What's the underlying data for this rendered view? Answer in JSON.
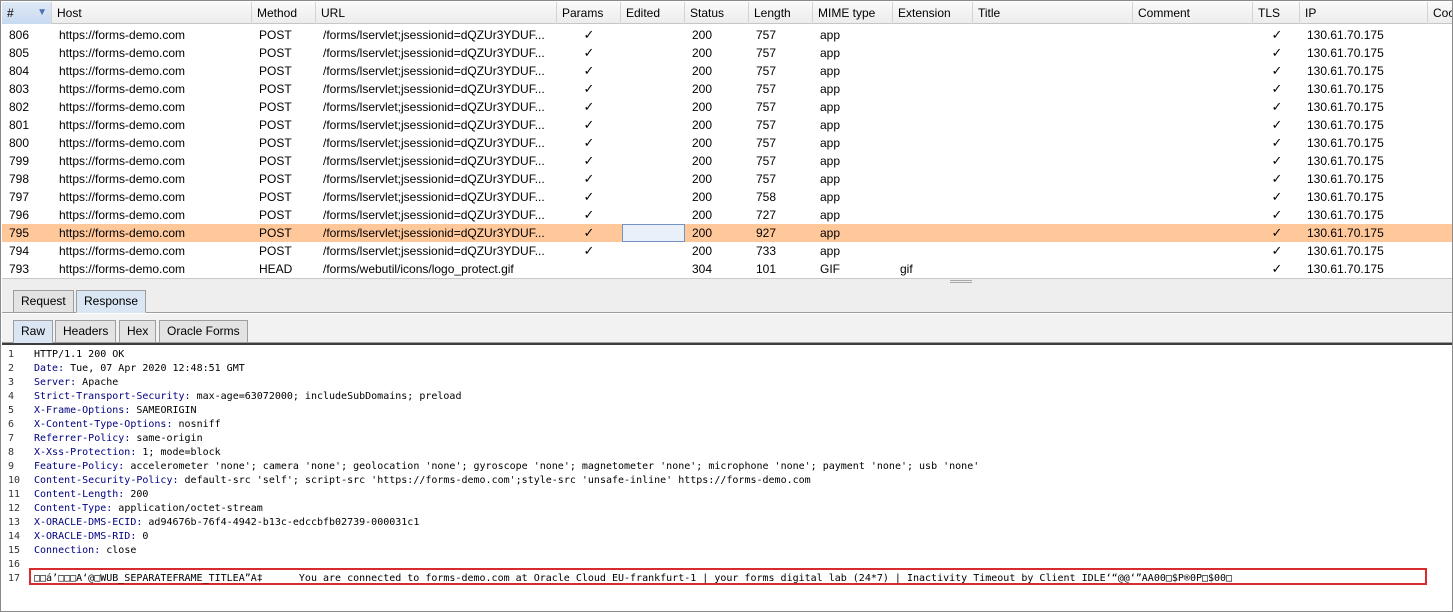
{
  "table": {
    "columns": [
      "#",
      "Host",
      "Method",
      "URL",
      "Params",
      "Edited",
      "Status",
      "Length",
      "MIME type",
      "Extension",
      "Title",
      "Comment",
      "TLS",
      "IP",
      "Cookies"
    ],
    "columns_visible": [
      "#",
      "Host",
      "Method",
      "URL",
      "Params",
      "Edited",
      "Status",
      "Length",
      "MIME type",
      "Extension",
      "Title",
      "Comment",
      "TLS",
      "IP",
      "Coo"
    ],
    "sort_indicator": "▼",
    "check": "✓",
    "rows": [
      {
        "num": "806",
        "host": "https://forms-demo.com",
        "method": "POST",
        "url": "/forms/lservlet;jsessionid=dQZUr3YDUF...",
        "params": true,
        "status": "200",
        "length": "757",
        "mime": "app",
        "ext": "",
        "tls": true,
        "ip": "130.61.70.175"
      },
      {
        "num": "805",
        "host": "https://forms-demo.com",
        "method": "POST",
        "url": "/forms/lservlet;jsessionid=dQZUr3YDUF...",
        "params": true,
        "status": "200",
        "length": "757",
        "mime": "app",
        "ext": "",
        "tls": true,
        "ip": "130.61.70.175"
      },
      {
        "num": "804",
        "host": "https://forms-demo.com",
        "method": "POST",
        "url": "/forms/lservlet;jsessionid=dQZUr3YDUF...",
        "params": true,
        "status": "200",
        "length": "757",
        "mime": "app",
        "ext": "",
        "tls": true,
        "ip": "130.61.70.175"
      },
      {
        "num": "803",
        "host": "https://forms-demo.com",
        "method": "POST",
        "url": "/forms/lservlet;jsessionid=dQZUr3YDUF...",
        "params": true,
        "status": "200",
        "length": "757",
        "mime": "app",
        "ext": "",
        "tls": true,
        "ip": "130.61.70.175"
      },
      {
        "num": "802",
        "host": "https://forms-demo.com",
        "method": "POST",
        "url": "/forms/lservlet;jsessionid=dQZUr3YDUF...",
        "params": true,
        "status": "200",
        "length": "757",
        "mime": "app",
        "ext": "",
        "tls": true,
        "ip": "130.61.70.175"
      },
      {
        "num": "801",
        "host": "https://forms-demo.com",
        "method": "POST",
        "url": "/forms/lservlet;jsessionid=dQZUr3YDUF...",
        "params": true,
        "status": "200",
        "length": "757",
        "mime": "app",
        "ext": "",
        "tls": true,
        "ip": "130.61.70.175"
      },
      {
        "num": "800",
        "host": "https://forms-demo.com",
        "method": "POST",
        "url": "/forms/lservlet;jsessionid=dQZUr3YDUF...",
        "params": true,
        "status": "200",
        "length": "757",
        "mime": "app",
        "ext": "",
        "tls": true,
        "ip": "130.61.70.175"
      },
      {
        "num": "799",
        "host": "https://forms-demo.com",
        "method": "POST",
        "url": "/forms/lservlet;jsessionid=dQZUr3YDUF...",
        "params": true,
        "status": "200",
        "length": "757",
        "mime": "app",
        "ext": "",
        "tls": true,
        "ip": "130.61.70.175"
      },
      {
        "num": "798",
        "host": "https://forms-demo.com",
        "method": "POST",
        "url": "/forms/lservlet;jsessionid=dQZUr3YDUF...",
        "params": true,
        "status": "200",
        "length": "757",
        "mime": "app",
        "ext": "",
        "tls": true,
        "ip": "130.61.70.175"
      },
      {
        "num": "797",
        "host": "https://forms-demo.com",
        "method": "POST",
        "url": "/forms/lservlet;jsessionid=dQZUr3YDUF...",
        "params": true,
        "status": "200",
        "length": "758",
        "mime": "app",
        "ext": "",
        "tls": true,
        "ip": "130.61.70.175"
      },
      {
        "num": "796",
        "host": "https://forms-demo.com",
        "method": "POST",
        "url": "/forms/lservlet;jsessionid=dQZUr3YDUF...",
        "params": true,
        "status": "200",
        "length": "727",
        "mime": "app",
        "ext": "",
        "tls": true,
        "ip": "130.61.70.175"
      },
      {
        "num": "795",
        "host": "https://forms-demo.com",
        "method": "POST",
        "url": "/forms/lservlet;jsessionid=dQZUr3YDUF...",
        "params": true,
        "status": "200",
        "length": "927",
        "mime": "app",
        "ext": "",
        "tls": true,
        "ip": "130.61.70.175",
        "selected": true
      },
      {
        "num": "794",
        "host": "https://forms-demo.com",
        "method": "POST",
        "url": "/forms/lservlet;jsessionid=dQZUr3YDUF...",
        "params": true,
        "status": "200",
        "length": "733",
        "mime": "app",
        "ext": "",
        "tls": true,
        "ip": "130.61.70.175"
      },
      {
        "num": "793",
        "host": "https://forms-demo.com",
        "method": "HEAD",
        "url": "/forms/webutil/icons/logo_protect.gif",
        "params": false,
        "status": "304",
        "length": "101",
        "mime": "GIF",
        "ext": "gif",
        "tls": true,
        "ip": "130.61.70.175"
      }
    ]
  },
  "outer_tabs": [
    "Request",
    "Response"
  ],
  "outer_active": "Response",
  "inner_tabs": [
    "Raw",
    "Headers",
    "Hex",
    "Oracle Forms"
  ],
  "inner_active": "Raw",
  "response_lines": [
    {
      "n": "1",
      "name": "",
      "value": "HTTP/1.1 200 OK"
    },
    {
      "n": "2",
      "name": "Date",
      "value": " Tue, 07 Apr 2020 12:48:51 GMT"
    },
    {
      "n": "3",
      "name": "Server",
      "value": " Apache"
    },
    {
      "n": "4",
      "name": "Strict-Transport-Security",
      "value": " max-age=63072000; includeSubDomains; preload"
    },
    {
      "n": "5",
      "name": "X-Frame-Options",
      "value": " SAMEORIGIN"
    },
    {
      "n": "6",
      "name": "X-Content-Type-Options",
      "value": " nosniff"
    },
    {
      "n": "7",
      "name": "Referrer-Policy",
      "value": " same-origin"
    },
    {
      "n": "8",
      "name": "X-Xss-Protection",
      "value": " 1; mode=block"
    },
    {
      "n": "9",
      "name": "Feature-Policy",
      "value": " accelerometer 'none'; camera 'none'; geolocation 'none'; gyroscope 'none'; magnetometer 'none'; microphone 'none'; payment 'none'; usb 'none'"
    },
    {
      "n": "10",
      "name": "Content-Security-Policy",
      "value": " default-src 'self'; script-src 'https://forms-demo.com';style-src 'unsafe-inline' https://forms-demo.com"
    },
    {
      "n": "11",
      "name": "Content-Length",
      "value": " 200"
    },
    {
      "n": "12",
      "name": "Content-Type",
      "value": " application/octet-stream"
    },
    {
      "n": "13",
      "name": "X-ORACLE-DMS-ECID",
      "value": " ad94676b-76f4-4942-b13c-edccbfb02739-000031c1"
    },
    {
      "n": "14",
      "name": "X-ORACLE-DMS-RID",
      "value": " 0"
    },
    {
      "n": "15",
      "name": "Connection",
      "value": " close"
    },
    {
      "n": "16",
      "name": "",
      "value": ""
    },
    {
      "n": "17",
      "name": "",
      "value": "□□á’□□□A‘@□WUB_SEPARATEFRAME_TITLEA”A‡      You are connected to forms-demo.com at Oracle Cloud EU-frankfurt-1 | your forms digital lab (24*7) | Inactivity Timeout by Client IDLE‘“@@‘”AA00□$P®0P□$00□"
    }
  ],
  "colors": {
    "selected_row": "#ffc89b",
    "header_name": "#000080",
    "highlight_border": "#d92b2b"
  }
}
